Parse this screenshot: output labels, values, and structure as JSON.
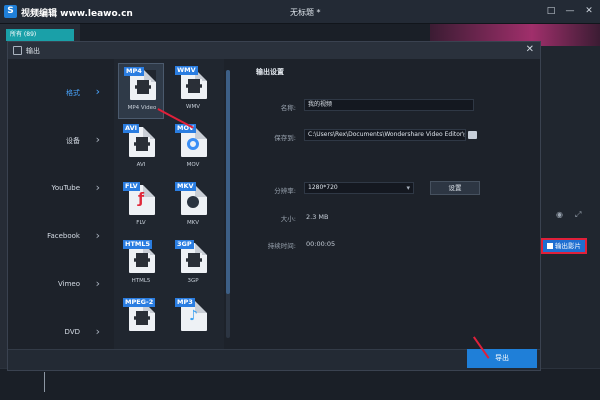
{
  "app": {
    "logo_glyph": "S",
    "title": "视频编辑 www.leawo.cn",
    "document_title": "无标题 *",
    "window_buttons": [
      "□",
      "—",
      "✕"
    ]
  },
  "background": {
    "media_tab": "所有 (89)",
    "export_video_button": "输出影片",
    "ctrl_icons": [
      "◉",
      "⤢"
    ]
  },
  "dialog": {
    "title": "输出",
    "close": "✕",
    "categories": [
      {
        "label": "格式",
        "active": true
      },
      {
        "label": "设备",
        "active": false
      },
      {
        "label": "YouTube",
        "active": false
      },
      {
        "label": "Facebook",
        "active": false
      },
      {
        "label": "Vimeo",
        "active": false
      },
      {
        "label": "DVD",
        "active": false
      }
    ],
    "chevron": "›",
    "formats": [
      {
        "tag": "MP4",
        "caption": "MP4 Video",
        "style": "film",
        "selected": true
      },
      {
        "tag": "WMV",
        "caption": "WMV",
        "style": "film",
        "selected": false
      },
      {
        "tag": "AVI",
        "caption": "AVI",
        "style": "film",
        "selected": false
      },
      {
        "tag": "MOV",
        "caption": "MOV",
        "style": "quicktime",
        "selected": false
      },
      {
        "tag": "FLV",
        "caption": "FLV",
        "style": "flash",
        "selected": false
      },
      {
        "tag": "MKV",
        "caption": "MKV",
        "style": "mkv",
        "selected": false
      },
      {
        "tag": "HTML5",
        "caption": "HTML5",
        "style": "film",
        "selected": false
      },
      {
        "tag": "3GP",
        "caption": "3GP",
        "style": "film",
        "selected": false
      },
      {
        "tag": "MPEG-2",
        "caption": "",
        "style": "film",
        "selected": false
      },
      {
        "tag": "MP3",
        "caption": "",
        "style": "audio",
        "selected": false
      }
    ],
    "settings": {
      "title": "输出设置",
      "name_label": "名称:",
      "name_value": "我的视频",
      "path_label": "保存到:",
      "path_value": "C:\\Users\\Rex\\Documents\\Wondershare Video Editor\\Output\\",
      "resolution_label": "分辨率:",
      "resolution_value": "1280*720",
      "setup_button": "设置",
      "size_label": "大小:",
      "size_value": "2.3 MB",
      "duration_label": "持续时间:",
      "duration_value": "00:00:05"
    },
    "export_button": "导出"
  },
  "colors": {
    "accent_blue": "#1f7fd8",
    "annotation_red": "#e0203a",
    "teal_tab": "#1aa0a8"
  }
}
